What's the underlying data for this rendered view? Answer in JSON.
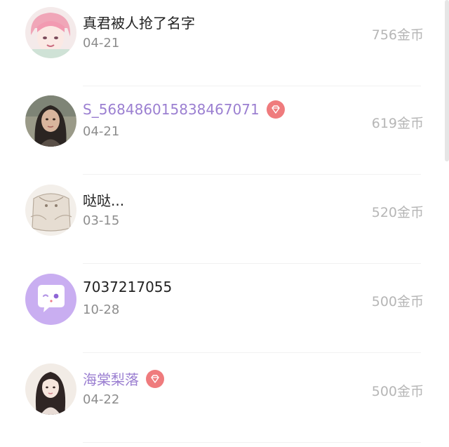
{
  "list": [
    {
      "avatar": "anime-girl-pink-hair",
      "name": "真君被人抢了名字",
      "vip": false,
      "date": "04-21",
      "amount": "756金币"
    },
    {
      "avatar": "woman-photo",
      "name": "S_568486015838467071",
      "vip": true,
      "date": "04-21",
      "amount": "619金币"
    },
    {
      "avatar": "sketch-character",
      "name": "哒哒...",
      "vip": false,
      "date": "03-15",
      "amount": "520金币"
    },
    {
      "avatar": "default-chat-bubble",
      "name": "7037217055",
      "vip": false,
      "date": "10-28",
      "amount": "500金币"
    },
    {
      "avatar": "anime-girl-dark-hair",
      "name": "海棠梨落",
      "vip": true,
      "date": "04-22",
      "amount": "500金币"
    }
  ],
  "colors": {
    "vip_name": "#9b7fd1",
    "vip_badge": "#ef7b7d",
    "default_avatar": "#c9aef1",
    "amount": "#b6b6b6"
  }
}
